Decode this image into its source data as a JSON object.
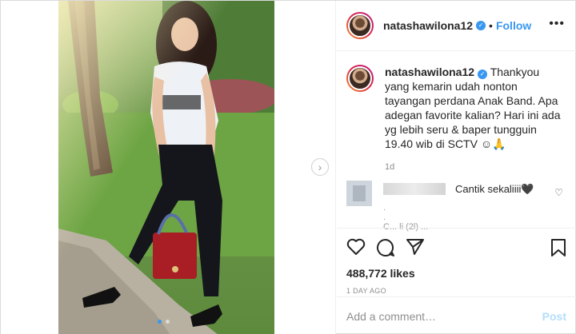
{
  "post": {
    "username": "natashawilona12",
    "separator": "•",
    "follow_label": "Follow",
    "more_label": "•••",
    "caption": "Thankyou yang kemarin udah nonton tayangan perdana Anak Band. Apa adegan favorite kalian? Hari ini ada yg lebih seru & baper tungguin 19.40 wib di SCTV ☺🙏",
    "caption_time": "1d",
    "comment": {
      "text": "Cantik sekaliiii🖤",
      "faint_lines": [
        ".",
        ".",
        "C... li  (2l) ..."
      ]
    },
    "likes": "488,772 likes",
    "posted_ago": "1 DAY AGO",
    "add_comment_placeholder": "Add a comment…",
    "post_label": "Post",
    "carousel": {
      "slides": 2,
      "active": 0
    }
  },
  "colors": {
    "accent": "#3897f0",
    "post_disabled": "#b2dffc",
    "muted": "#8e8e8e"
  },
  "icons": [
    "verified-badge-icon",
    "more-options-icon",
    "next-slide-icon",
    "heart-icon",
    "comment-icon",
    "share-icon",
    "bookmark-icon",
    "comment-like-icon"
  ]
}
